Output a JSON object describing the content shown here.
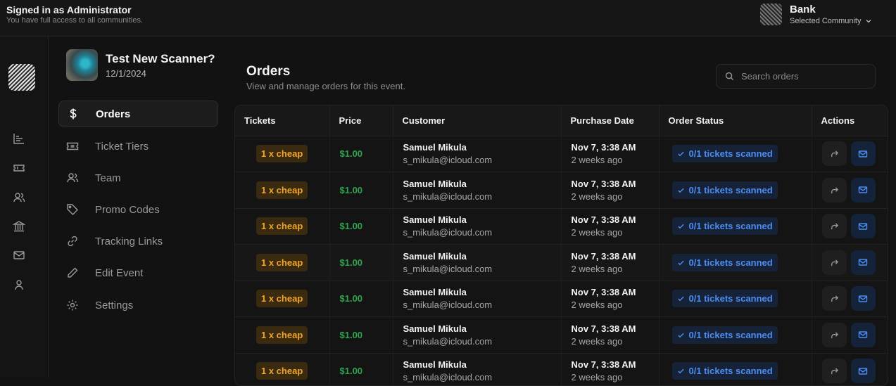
{
  "header": {
    "signed_in": "Signed in as Administrator",
    "access_note": "You have full access to all communities.",
    "community_name": "Bank",
    "community_label": "Selected Community"
  },
  "rail": {
    "icons": [
      "chart-icon",
      "ticket-icon",
      "users-icon",
      "bank-icon",
      "mail-icon",
      "user-icon"
    ]
  },
  "event": {
    "title": "Test New Scanner?",
    "date": "12/1/2024"
  },
  "nav": [
    {
      "label": "Orders",
      "icon": "dollar-icon",
      "active": true
    },
    {
      "label": "Ticket Tiers",
      "icon": "ticket-icon"
    },
    {
      "label": "Team",
      "icon": "users-icon"
    },
    {
      "label": "Promo Codes",
      "icon": "tag-icon"
    },
    {
      "label": "Tracking Links",
      "icon": "link-icon"
    },
    {
      "label": "Edit Event",
      "icon": "pencil-icon"
    },
    {
      "label": "Settings",
      "icon": "gear-icon"
    }
  ],
  "main": {
    "title": "Orders",
    "subtitle": "View and manage orders for this event.",
    "search_placeholder": "Search orders"
  },
  "table": {
    "headers": [
      "Tickets",
      "Price",
      "Customer",
      "Purchase Date",
      "Order Status",
      "Actions"
    ],
    "rows": [
      {
        "tickets": "1 x cheap",
        "price": "$1.00",
        "name": "Samuel Mikula",
        "email": "s_mikula@icloud.com",
        "date": "Nov 7, 3:38 AM",
        "relative": "2 weeks ago",
        "status": "0/1 tickets scanned"
      },
      {
        "tickets": "1 x cheap",
        "price": "$1.00",
        "name": "Samuel Mikula",
        "email": "s_mikula@icloud.com",
        "date": "Nov 7, 3:38 AM",
        "relative": "2 weeks ago",
        "status": "0/1 tickets scanned"
      },
      {
        "tickets": "1 x cheap",
        "price": "$1.00",
        "name": "Samuel Mikula",
        "email": "s_mikula@icloud.com",
        "date": "Nov 7, 3:38 AM",
        "relative": "2 weeks ago",
        "status": "0/1 tickets scanned"
      },
      {
        "tickets": "1 x cheap",
        "price": "$1.00",
        "name": "Samuel Mikula",
        "email": "s_mikula@icloud.com",
        "date": "Nov 7, 3:38 AM",
        "relative": "2 weeks ago",
        "status": "0/1 tickets scanned"
      },
      {
        "tickets": "1 x cheap",
        "price": "$1.00",
        "name": "Samuel Mikula",
        "email": "s_mikula@icloud.com",
        "date": "Nov 7, 3:38 AM",
        "relative": "2 weeks ago",
        "status": "0/1 tickets scanned"
      },
      {
        "tickets": "1 x cheap",
        "price": "$1.00",
        "name": "Samuel Mikula",
        "email": "s_mikula@icloud.com",
        "date": "Nov 7, 3:38 AM",
        "relative": "2 weeks ago",
        "status": "0/1 tickets scanned"
      },
      {
        "tickets": "1 x cheap",
        "price": "$1.00",
        "name": "Samuel Mikula",
        "email": "s_mikula@icloud.com",
        "date": "Nov 7, 3:38 AM",
        "relative": "2 weeks ago",
        "status": "0/1 tickets scanned"
      }
    ]
  },
  "colors": {
    "background": "#121212",
    "tier_badge_text": "#f0a62a",
    "price_green": "#2fa44f",
    "status_blue": "#4d8df0"
  }
}
